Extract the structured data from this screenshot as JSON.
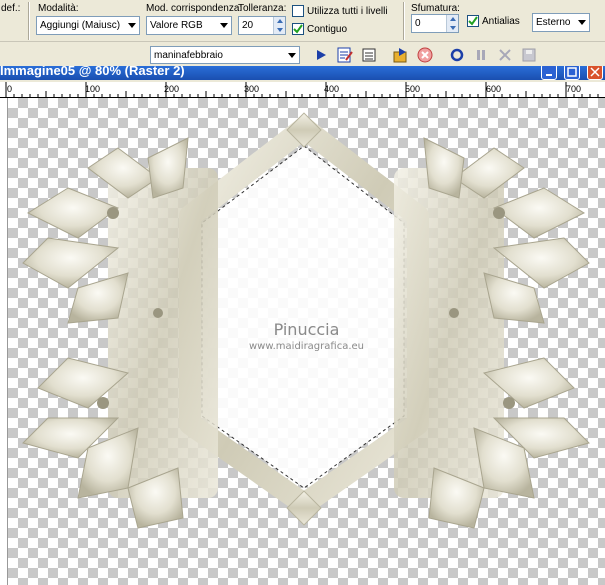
{
  "toolbar": {
    "presets_label": "def.:",
    "mode_label": "Modalità:",
    "mode_value": "Aggiungi (Maiusc)",
    "match_label": "Mod. corrispondenza:",
    "match_value": "Valore RGB",
    "tolerance_label": "Tolleranza:",
    "tolerance_value": "20",
    "use_all_layers_label": "Utilizza tutti i livelli",
    "contiguous_label": "Contiguo",
    "feather_label": "Sfumatura:",
    "feather_value": "0",
    "antialias_label": "Antialias",
    "antialias_mode": "Esterno"
  },
  "script_bar": {
    "script_name": "maninafebbraio"
  },
  "window": {
    "title": "Immagine05 @ 80% (Raster 2)"
  },
  "ruler": {
    "labels": [
      "0",
      "100",
      "200",
      "300",
      "400",
      "500",
      "600",
      "700"
    ]
  },
  "canvas": {
    "watermark_title": "Pinuccia",
    "watermark_url": "www.maidiragrafica.eu"
  },
  "colors": {
    "titlebar": "#1a4fb0",
    "frame": "#d6d3c3",
    "canvas_check": "#c8c8c8"
  }
}
